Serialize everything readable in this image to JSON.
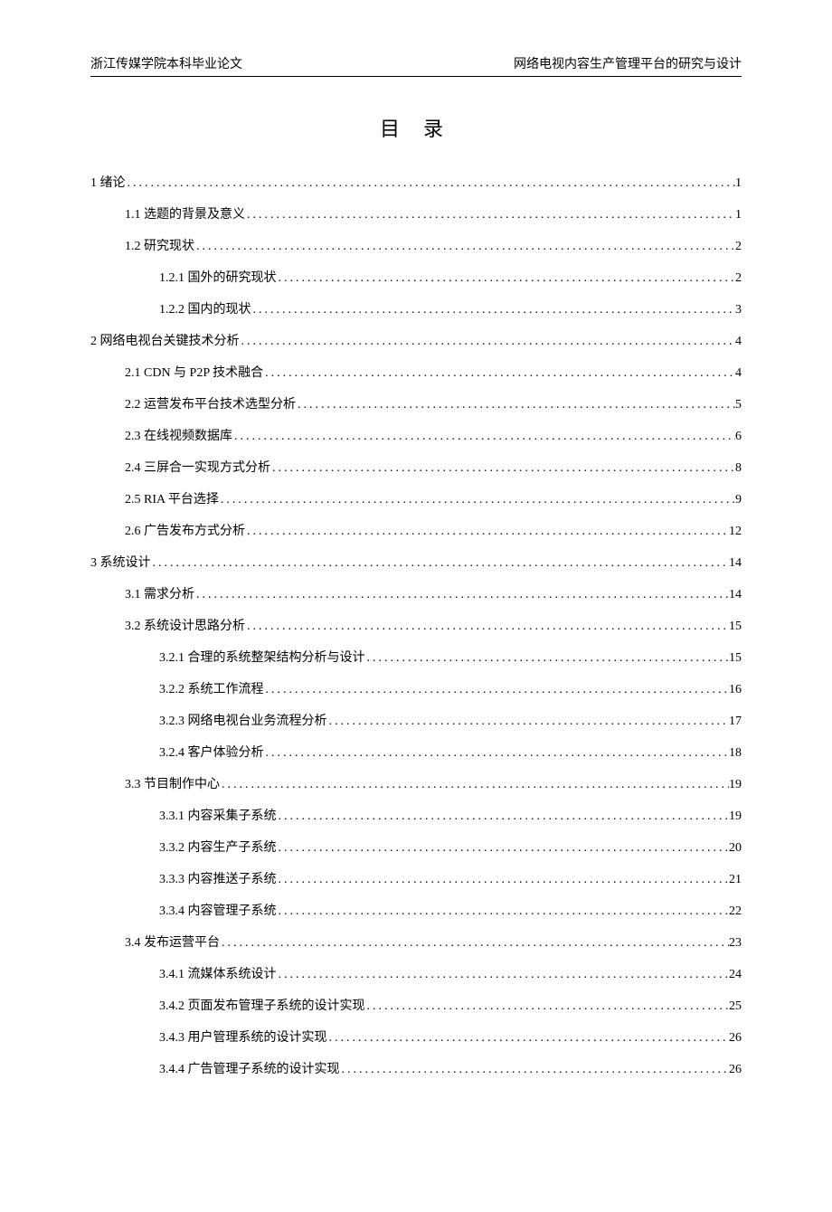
{
  "header_left": "浙江传媒学院本科毕业论文",
  "header_right": "网络电视内容生产管理平台的研究与设计",
  "toc_title": "目 录",
  "entries": [
    {
      "level": 0,
      "label": "1 绪论",
      "page": "1"
    },
    {
      "level": 1,
      "label": "1.1 选题的背景及意义",
      "page": "1"
    },
    {
      "level": 1,
      "label": "1.2 研究现状",
      "page": "2"
    },
    {
      "level": 2,
      "label": "1.2.1 国外的研究现状",
      "page": "2"
    },
    {
      "level": 2,
      "label": "1.2.2 国内的现状",
      "page": "3"
    },
    {
      "level": 0,
      "label": "2 网络电视台关键技术分析",
      "page": "4"
    },
    {
      "level": 1,
      "label": "2.1 CDN 与 P2P 技术融合",
      "page": "4"
    },
    {
      "level": 1,
      "label": "2.2 运营发布平台技术选型分析",
      "page": "5"
    },
    {
      "level": 1,
      "label": "2.3 在线视频数据库",
      "page": "6"
    },
    {
      "level": 1,
      "label": "2.4 三屏合一实现方式分析",
      "page": "8"
    },
    {
      "level": 1,
      "label": "2.5 RIA 平台选择",
      "page": "9"
    },
    {
      "level": 1,
      "label": "2.6 广告发布方式分析",
      "page": "12"
    },
    {
      "level": 0,
      "label": "3 系统设计",
      "page": "14"
    },
    {
      "level": 1,
      "label": "3.1 需求分析",
      "page": "14"
    },
    {
      "level": 1,
      "label": "3.2 系统设计思路分析",
      "page": "15"
    },
    {
      "level": 2,
      "label": "3.2.1 合理的系统整架结构分析与设计",
      "page": "15"
    },
    {
      "level": 2,
      "label": "3.2.2 系统工作流程",
      "page": "16"
    },
    {
      "level": 2,
      "label": "3.2.3 网络电视台业务流程分析",
      "page": "17"
    },
    {
      "level": 2,
      "label": "3.2.4 客户体验分析",
      "page": "18"
    },
    {
      "level": 1,
      "label": "3.3 节目制作中心",
      "page": "19"
    },
    {
      "level": 2,
      "label": "3.3.1 内容采集子系统",
      "page": "19"
    },
    {
      "level": 2,
      "label": "3.3.2 内容生产子系统",
      "page": "20"
    },
    {
      "level": 2,
      "label": "3.3.3 内容推送子系统",
      "page": "21"
    },
    {
      "level": 2,
      "label": "3.3.4 内容管理子系统",
      "page": "22"
    },
    {
      "level": 1,
      "label": "3.4 发布运营平台",
      "page": "23"
    },
    {
      "level": 2,
      "label": "3.4.1 流媒体系统设计",
      "page": "24"
    },
    {
      "level": 2,
      "label": "3.4.2 页面发布管理子系统的设计实现",
      "page": "25"
    },
    {
      "level": 2,
      "label": "3.4.3 用户管理系统的设计实现",
      "page": "26"
    },
    {
      "level": 2,
      "label": "3.4.4 广告管理子系统的设计实现",
      "page": "26"
    }
  ]
}
